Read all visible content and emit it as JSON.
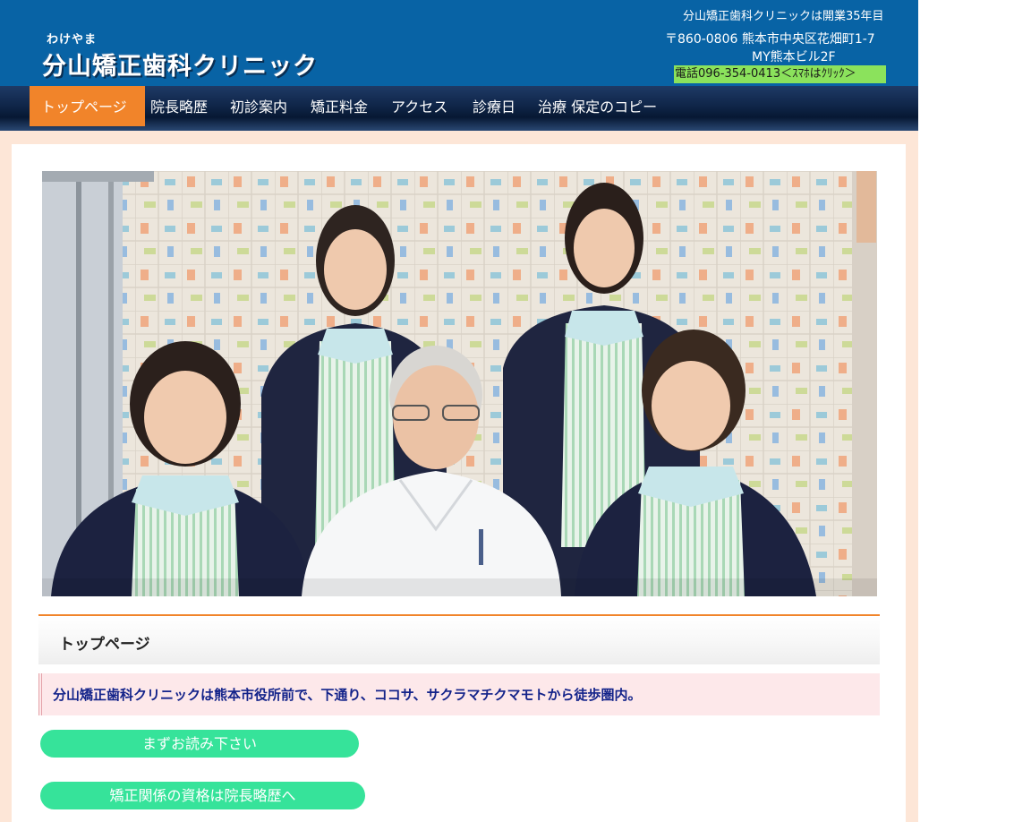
{
  "header": {
    "logo_ruby": "わけやま",
    "logo_name": "分山矯正歯科クリニック",
    "years_text": "分山矯正歯科クリニックは開業35年目",
    "address": "〒860-0806 熊本市中央区花畑町1-7",
    "building": "MY熊本ビル2F",
    "phone": "電話096-354-0413＜ｽﾏﾎはｸﾘｯｸ＞",
    "colors": {
      "header_bg": "#0863a5",
      "phone_bg": "#8be25c"
    }
  },
  "nav": {
    "items": [
      {
        "label": "トップページ",
        "active": true
      },
      {
        "label": "院長略歴"
      },
      {
        "label": "初診案内"
      },
      {
        "label": "矯正料金"
      },
      {
        "label": "アクセス"
      },
      {
        "label": "診療日"
      },
      {
        "label": "治療 保定のコピー"
      }
    ],
    "colors": {
      "active_bg": "#f1842a",
      "bar_bg": "#0f2548"
    }
  },
  "main": {
    "hero_image": "staff-group-photo",
    "section_heading": "トップページ",
    "lead_text": "分山矯正歯科クリニックは熊本市役所前で、下通り、ココサ、サクラマチクマモトから徒歩圏内。",
    "buttons": [
      {
        "label": "まずお読み下さい"
      },
      {
        "label": "矯正関係の資格は院長略歴へ"
      }
    ],
    "colors": {
      "page_bg": "#fde6d7",
      "heading_accent": "#f1842a",
      "lead_bg": "#fde8ea",
      "lead_text": "#13238a",
      "button_bg": "#36e39a"
    }
  }
}
